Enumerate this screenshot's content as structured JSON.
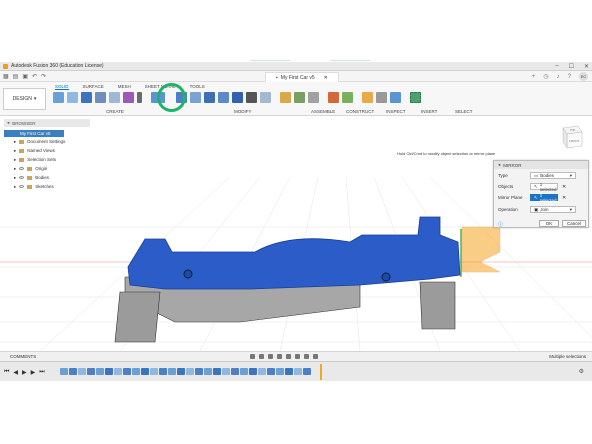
{
  "window": {
    "title": "Autodesk Fusion 360 (Education License)",
    "document_tab": "My First Car v5",
    "avatar_initials": "EC"
  },
  "ribbon": {
    "workspace": "DESIGN",
    "tabs": [
      "SOLID",
      "SURFACE",
      "MESH",
      "SHEET METAL",
      "TOOLS"
    ],
    "active_tab": "SOLID",
    "groups": [
      "CREATE",
      "MODIFY",
      "ASSEMBLE",
      "CONSTRUCT",
      "INSPECT",
      "INSERT",
      "SELECT"
    ]
  },
  "browser": {
    "header": "BROWSER",
    "root": "My First Car v5",
    "items": [
      "Document Settings",
      "Named Views",
      "Selection Sets",
      "Origin",
      "Bodies",
      "Sketches"
    ]
  },
  "tooltip": "Hold Ctrl/Cmd to modify object selection or mirror plane",
  "viewcube": {
    "top": "TOP",
    "front": "FRONT"
  },
  "mirror_dialog": {
    "title": "MIRROR",
    "type_label": "Type",
    "type_value": "Bodies",
    "objects_label": "Objects",
    "objects_value": "1 selected",
    "plane_label": "Mirror Plane",
    "plane_value": "1 selected",
    "operation_label": "Operation",
    "operation_value": "Join",
    "ok": "OK",
    "cancel": "Cancel"
  },
  "comments": {
    "label": "COMMENTS",
    "status": "Multiple selections"
  },
  "colors": {
    "accent": "#0a72c4",
    "body": "#2b5cc7",
    "highlight_ring": "#1db36a",
    "mirror_plane": "#f5a623"
  },
  "icons": [
    "grid-icon",
    "save-icon",
    "undo-icon",
    "redo-icon",
    "close-icon",
    "gear-icon",
    "help-icon",
    "bell-icon"
  ]
}
